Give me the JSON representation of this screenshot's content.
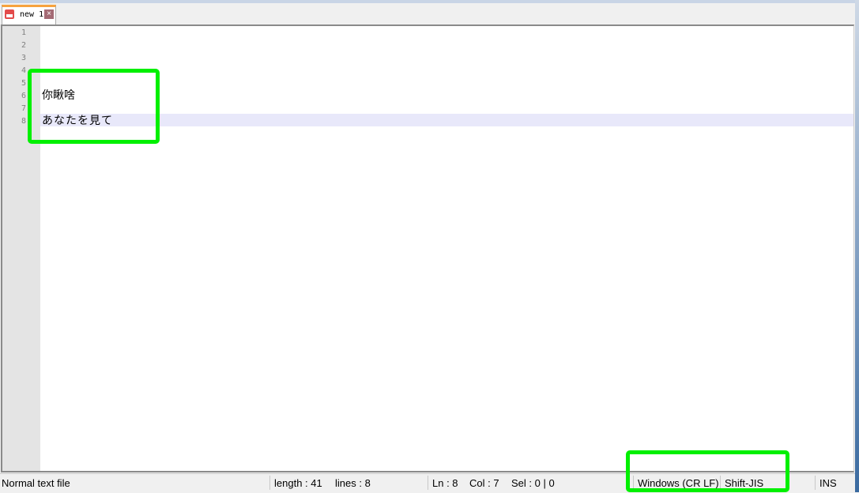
{
  "tab": {
    "label": "new 1",
    "icon": "save-icon",
    "close": "×"
  },
  "lines": [
    "1",
    "2",
    "3",
    "4",
    "5",
    "6",
    "7",
    "8"
  ],
  "content": {
    "line6": "你瞅啥",
    "line8": "あなたを見て"
  },
  "status": {
    "type": "Normal text file",
    "length": "length : 41",
    "lines": "lines : 8",
    "ln": "Ln : 8",
    "col": "Col : 7",
    "sel": "Sel : 0 | 0",
    "eol": "Windows (CR LF)",
    "encoding": "Shift-JIS",
    "mode": "INS"
  },
  "highlight_color": "#00f000"
}
